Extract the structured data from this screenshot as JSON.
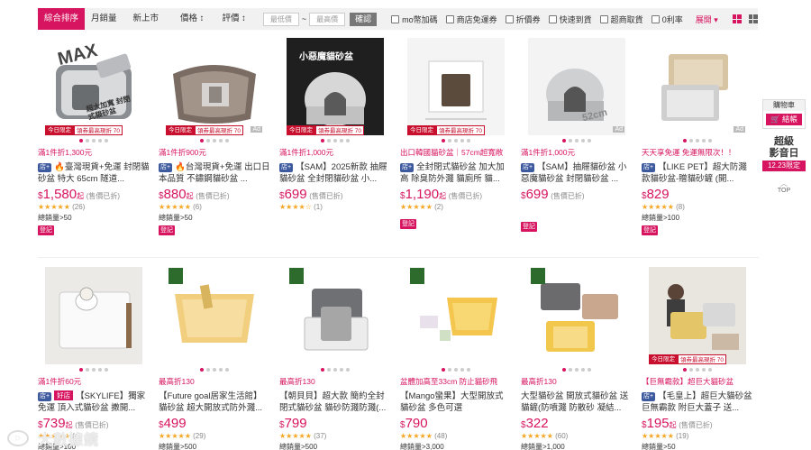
{
  "filter": {
    "sorts": [
      "綜合排序",
      "月銷量",
      "新上市",
      "價格 ↕",
      "評價 ↕"
    ],
    "price_min_placeholder": "最低價",
    "price_max_placeholder": "最高價",
    "tilde": "~",
    "confirm": "確認",
    "checks": [
      "mo幣加碼",
      "商店免運券",
      "折價券",
      "快速到貨",
      "超商取貨",
      "0利率"
    ],
    "expand": "展開 ▾"
  },
  "labels": {
    "today_a": "今日限定",
    "today_b": "領券最高現折 70",
    "ad": "Ad",
    "sold": "(售價已折)",
    "qi": "起",
    "login": "登記",
    "cur": "$",
    "shop": "店+",
    "good_shop": "好店"
  },
  "row1": [
    {
      "promo": "滿1件折1,300元",
      "title": "🔥臺灣現貨+免運 封閉貓砂盆 特大 65cm 隧道...",
      "price": "1,580",
      "qi": true,
      "stars": "★★★★★",
      "rating": "(26)",
      "sales": "總銷量>50",
      "img_text": "MAX",
      "img_sub": "超大加寬 封閉式貓砂盆",
      "today": true,
      "ad": false
    },
    {
      "promo": "滿1件折900元",
      "title": "🔥台灣現貨+免運 出口日本品質 不鏽鋼貓砂盆 ...",
      "price": "880",
      "qi": true,
      "stars": "★★★★★",
      "rating": "(6)",
      "sales": "總銷量>50",
      "today": true,
      "ad": true
    },
    {
      "promo": "滿1件折1,000元",
      "title": "【SAM】2025新款 抽屜貓砂盆 全封閉貓砂盆 小...",
      "price": "699",
      "qi": false,
      "stars": "★★★★☆",
      "rating": "(1)",
      "sales": "",
      "img_text": "小惡魔貓砂盆",
      "today": true,
      "ad": false
    },
    {
      "promo": "出口韓國貓砂盆｜57cm超寬敞",
      "title": "全封閉式貓砂盆 加大加高 除臭防外濺 貓廁所 貓...",
      "price": "1,190",
      "qi": true,
      "stars": "★★★★★",
      "rating": "(2)",
      "sales": "",
      "today": true,
      "ad": false
    },
    {
      "promo": "滿1件折1,000元",
      "title": "【SAM】抽屜貓砂盆 小惡魔貓砂盆 封閉貓砂盆 ...",
      "price": "699",
      "qi": false,
      "stars": "",
      "rating": "",
      "sales": "",
      "img_text": "52cm",
      "today": false,
      "ad": true
    },
    {
      "promo": "天天享免運 免運無限次！！",
      "title": "【LIKE PET】超大防濺款貓砂盆-贈貓砂鏟 (開...",
      "price": "829",
      "qi": false,
      "stars": "★★★★★",
      "rating": "(8)",
      "sales": "總銷量>100",
      "today": false,
      "ad": true
    }
  ],
  "row2": [
    {
      "promo": "滿1件折60元",
      "title": "【SKYLIFE】獨家 免運 頂入式貓砂盆 撒開...",
      "price": "739",
      "good": true,
      "qi": true,
      "stars": "★★★★★",
      "rating": "(4)",
      "sales": "總銷量>100"
    },
    {
      "promo": "最高折130",
      "title": "【Future goal居家生活館】貓砂盆 超大開放式防外濺...",
      "price": "499",
      "qi": false,
      "stars": "★★★★★",
      "rating": "(29)",
      "sales": "總銷量>500"
    },
    {
      "promo": "最高折130",
      "title": "【朝貝貝】超大款 簡約全封閉式貓砂盆 貓砂防濺防濺(...",
      "price": "799",
      "qi": false,
      "stars": "★★★★★",
      "rating": "(37)",
      "sales": "總銷量>500"
    },
    {
      "promo": "盆體加高至33cm 防止貓砂飛",
      "title": "【Mango蠻果】大型開放式貓砂盆 多色可選",
      "price": "790",
      "qi": false,
      "stars": "★★★★★",
      "rating": "(48)",
      "sales": "總銷量>3,000"
    },
    {
      "promo": "最高折130",
      "title": "大型貓砂盆 開放式貓砂盆 送貓鏟(防噴濺 防散砂 凝結...",
      "price": "322",
      "qi": false,
      "stars": "★★★★★",
      "rating": "(60)",
      "sales": "總銷量>1,000"
    },
    {
      "promo": "【巨無霸款】超巨大貓砂盆",
      "title": "【毛皇上】超巨大貓砂盆 巨無霸款 附巨大蓋子 送...",
      "price": "195",
      "qi": true,
      "stars": "★★★★★",
      "rating": "(19)",
      "sales": "總銷量>50",
      "today": true
    }
  ],
  "side": {
    "cart_label": "購物車",
    "checkout": "🛒 結帳",
    "vip1": "超級",
    "vip2": "影音日",
    "vip_date": "12.23限定",
    "top": "TOP",
    "arrow": "︿"
  },
  "watermark": "大數據鏡"
}
